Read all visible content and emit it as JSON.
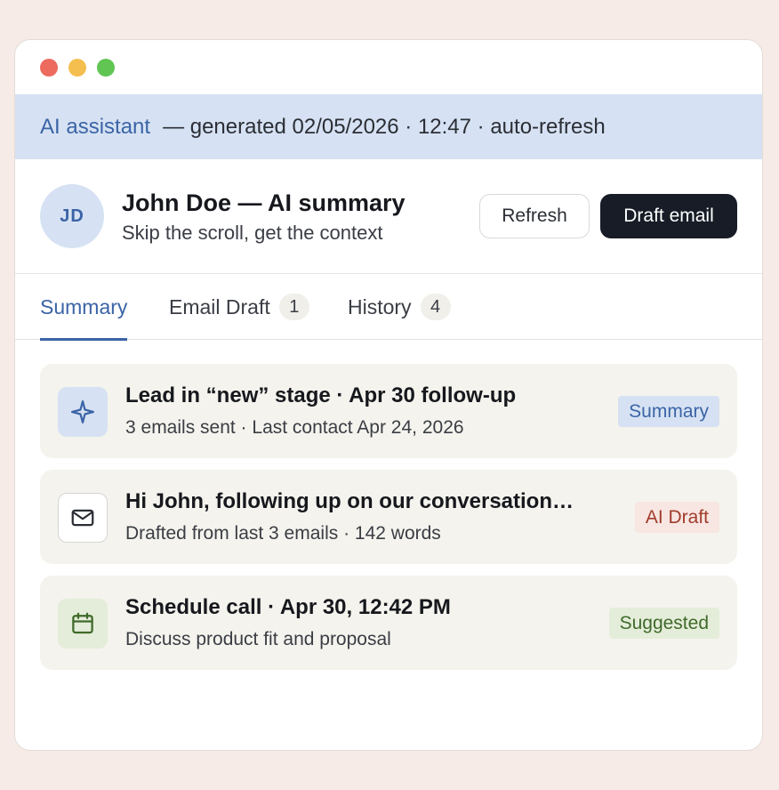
{
  "banner": {
    "brand": "AI assistant",
    "meta": "— generated 02/05/2026 · 12:47 · auto-refresh"
  },
  "contact": {
    "initials": "JD",
    "title": "John Doe — AI summary",
    "subtitle": "Skip the scroll, get the context"
  },
  "actions": {
    "refresh_label": "Refresh",
    "draft_label": "Draft email"
  },
  "tabs": [
    {
      "label": "Summary",
      "count": null,
      "active": true
    },
    {
      "label": "Email Draft",
      "count": "1",
      "active": false
    },
    {
      "label": "History",
      "count": "4",
      "active": false
    }
  ],
  "cards": [
    {
      "icon": "sparkle-icon",
      "title": "Lead in “new” stage · Apr 30 follow-up",
      "subtitle": "3 emails sent · Last contact Apr 24, 2026",
      "badge": "Summary"
    },
    {
      "icon": "mail-icon",
      "title": "Hi John, following up on our conversation…",
      "subtitle": "Drafted from last 3 emails · 142 words",
      "badge": "AI Draft"
    },
    {
      "icon": "calendar-icon",
      "title": "Schedule call · Apr 30, 12:42 PM",
      "subtitle": "Discuss product fit and proposal",
      "badge": "Suggested"
    }
  ],
  "colors": {
    "accent": "#3b64a6",
    "banner_bg": "#d6e2f3",
    "dark_button": "#171c26",
    "card_bg": "#f4f3ed",
    "draft_badge": "#a13c2b",
    "suggested_badge": "#3f6a2a"
  }
}
